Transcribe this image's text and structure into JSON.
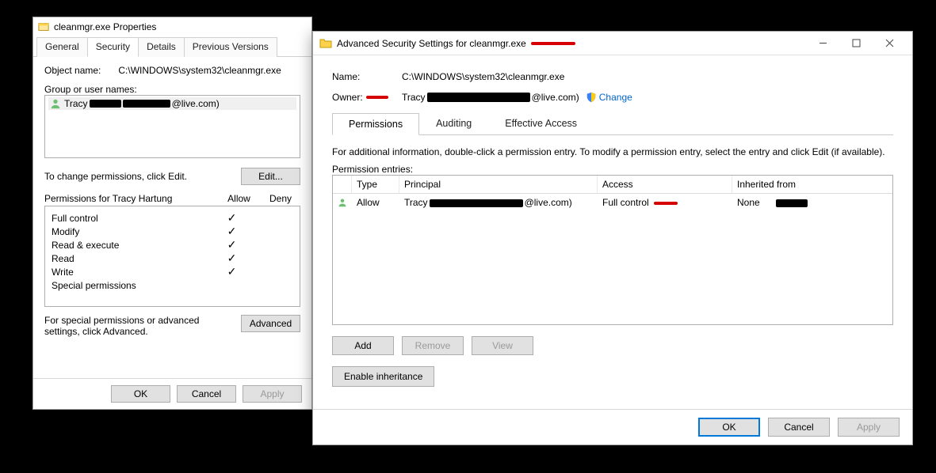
{
  "prop": {
    "title": "cleanmgr.exe Properties",
    "tabs": [
      "General",
      "Security",
      "Details",
      "Previous Versions"
    ],
    "active_tab": 1,
    "object_label": "Object name:",
    "object_path": "C:\\WINDOWS\\system32\\cleanmgr.exe",
    "group_label": "Group or user names:",
    "user_prefix": "Tracy",
    "user_suffix": "@live.com)",
    "change_msg": "To change permissions, click Edit.",
    "edit_btn": "Edit...",
    "perm_for": "Permissions for Tracy Hartung",
    "col_allow": "Allow",
    "col_deny": "Deny",
    "perms": [
      {
        "name": "Full control",
        "allow": true,
        "deny": false
      },
      {
        "name": "Modify",
        "allow": true,
        "deny": false
      },
      {
        "name": "Read & execute",
        "allow": true,
        "deny": false
      },
      {
        "name": "Read",
        "allow": true,
        "deny": false
      },
      {
        "name": "Write",
        "allow": true,
        "deny": false
      },
      {
        "name": "Special permissions",
        "allow": false,
        "deny": false
      }
    ],
    "advanced_msg": "For special permissions or advanced settings, click Advanced.",
    "advanced_btn": "Advanced",
    "ok": "OK",
    "cancel": "Cancel",
    "apply": "Apply"
  },
  "adv": {
    "title": "Advanced Security Settings for cleanmgr.exe",
    "name_label": "Name:",
    "name_value": "C:\\WINDOWS\\system32\\cleanmgr.exe",
    "owner_label": "Owner:",
    "owner_prefix": "Tracy",
    "owner_suffix": "@live.com)",
    "change_link": "Change",
    "tabs": [
      "Permissions",
      "Auditing",
      "Effective Access"
    ],
    "active_tab": 0,
    "hint": "For additional information, double-click a permission entry. To modify a permission entry, select the entry and click Edit (if available).",
    "entries_label": "Permission entries:",
    "cols": {
      "type": "Type",
      "principal": "Principal",
      "access": "Access",
      "inherited": "Inherited from"
    },
    "rows": [
      {
        "type": "Allow",
        "principal_prefix": "Tracy",
        "principal_suffix": "@live.com)",
        "access": "Full control",
        "inherited": "None"
      }
    ],
    "add": "Add",
    "remove": "Remove",
    "view": "View",
    "enable_inh": "Enable inheritance",
    "ok": "OK",
    "cancel": "Cancel",
    "apply": "Apply"
  }
}
